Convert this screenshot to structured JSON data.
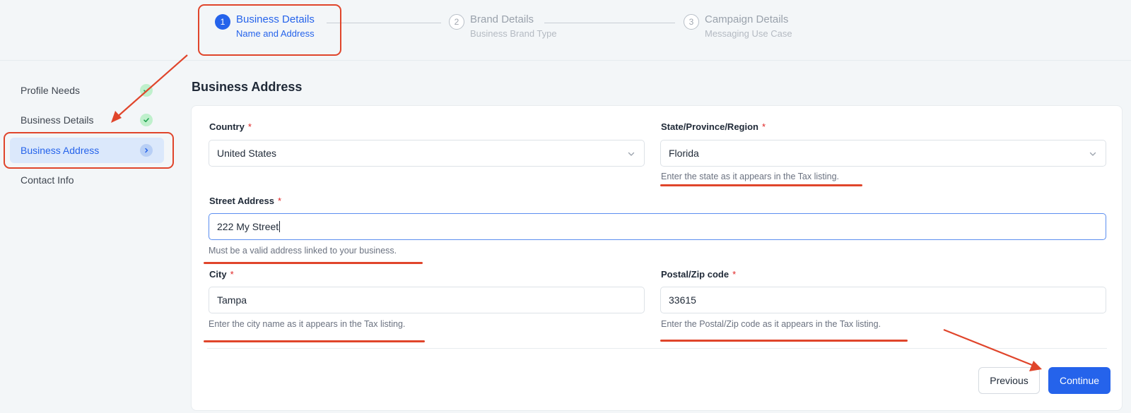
{
  "stepper": {
    "steps": [
      {
        "number": "1",
        "title": "Business Details",
        "subtitle": "Name and Address",
        "state": "active"
      },
      {
        "number": "2",
        "title": "Brand Details",
        "subtitle": "Business Brand Type",
        "state": "inactive"
      },
      {
        "number": "3",
        "title": "Campaign Details",
        "subtitle": "Messaging Use Case",
        "state": "inactive"
      }
    ]
  },
  "sidebar": {
    "items": [
      {
        "label": "Profile Needs",
        "status": "complete"
      },
      {
        "label": "Business Details",
        "status": "complete"
      },
      {
        "label": "Business Address",
        "status": "current"
      },
      {
        "label": "Contact Info",
        "status": "pending"
      }
    ]
  },
  "main": {
    "section_title": "Business Address",
    "form": {
      "country": {
        "label": "Country",
        "value": "United States"
      },
      "state": {
        "label": "State/Province/Region",
        "value": "Florida",
        "hint": "Enter the state as it appears in the Tax listing."
      },
      "street": {
        "label": "Street Address",
        "value": "222 My Street",
        "hint": "Must be a valid address linked to your business."
      },
      "city": {
        "label": "City",
        "value": "Tampa",
        "hint": "Enter the city name as it appears in the Tax listing."
      },
      "postal": {
        "label": "Postal/Zip code",
        "value": "33615",
        "hint": "Enter the Postal/Zip code as it appears in the Tax listing."
      },
      "required_marker": "*"
    },
    "buttons": {
      "previous": "Previous",
      "continue": "Continue"
    }
  },
  "colors": {
    "accent": "#2563eb",
    "annotation": "#e0452b",
    "success": "#bff0cc"
  },
  "icons": {
    "complete": "check-icon",
    "current": "chevron-right-icon",
    "dropdown": "chevron-down-icon"
  }
}
